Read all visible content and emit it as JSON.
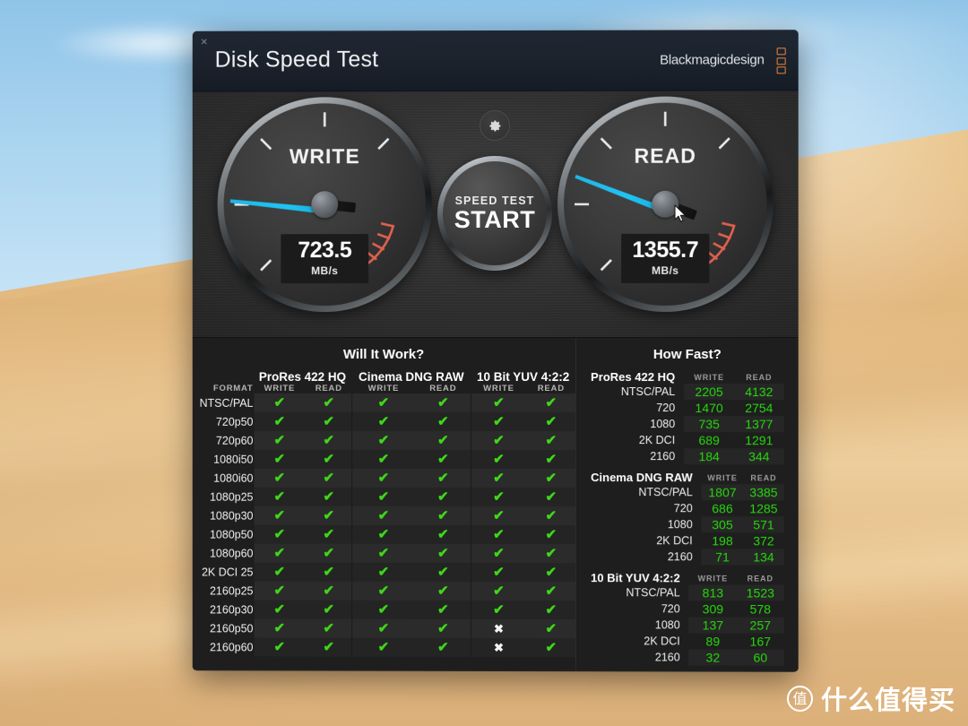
{
  "window": {
    "title": "Disk Speed Test",
    "brand": "Blackmagicdesign",
    "close_label": "×"
  },
  "gauges": {
    "write": {
      "label": "WRITE",
      "value": "723.5",
      "unit": "MB/s",
      "needle_angle_deg": 186
    },
    "read": {
      "label": "READ",
      "value": "1355.7",
      "unit": "MB/s",
      "needle_angle_deg": 201
    }
  },
  "controls": {
    "settings_icon": "gear-icon",
    "start_top_label": "SPEED TEST",
    "start_main_label": "START"
  },
  "will_it_work": {
    "heading": "Will It Work?",
    "format_header": "FORMAT",
    "groups": [
      "ProRes 422 HQ",
      "Cinema DNG RAW",
      "10 Bit YUV 4:2:2"
    ],
    "sub_headers": [
      "WRITE",
      "READ"
    ],
    "ok_mark": "✔",
    "fail_mark": "✖",
    "rows": [
      {
        "format": "NTSC/PAL",
        "marks": [
          true,
          true,
          true,
          true,
          true,
          true
        ]
      },
      {
        "format": "720p50",
        "marks": [
          true,
          true,
          true,
          true,
          true,
          true
        ]
      },
      {
        "format": "720p60",
        "marks": [
          true,
          true,
          true,
          true,
          true,
          true
        ]
      },
      {
        "format": "1080i50",
        "marks": [
          true,
          true,
          true,
          true,
          true,
          true
        ]
      },
      {
        "format": "1080i60",
        "marks": [
          true,
          true,
          true,
          true,
          true,
          true
        ]
      },
      {
        "format": "1080p25",
        "marks": [
          true,
          true,
          true,
          true,
          true,
          true
        ]
      },
      {
        "format": "1080p30",
        "marks": [
          true,
          true,
          true,
          true,
          true,
          true
        ]
      },
      {
        "format": "1080p50",
        "marks": [
          true,
          true,
          true,
          true,
          true,
          true
        ]
      },
      {
        "format": "1080p60",
        "marks": [
          true,
          true,
          true,
          true,
          true,
          true
        ]
      },
      {
        "format": "2K DCI 25",
        "marks": [
          true,
          true,
          true,
          true,
          true,
          true
        ]
      },
      {
        "format": "2160p25",
        "marks": [
          true,
          true,
          true,
          true,
          true,
          true
        ]
      },
      {
        "format": "2160p30",
        "marks": [
          true,
          true,
          true,
          true,
          true,
          true
        ]
      },
      {
        "format": "2160p50",
        "marks": [
          true,
          true,
          true,
          true,
          false,
          true
        ]
      },
      {
        "format": "2160p60",
        "marks": [
          true,
          true,
          true,
          true,
          false,
          true
        ]
      }
    ]
  },
  "how_fast": {
    "heading": "How Fast?",
    "col_write": "WRITE",
    "col_read": "READ",
    "sections": [
      {
        "title": "ProRes 422 HQ",
        "rows": [
          {
            "format": "NTSC/PAL",
            "write": "2205",
            "read": "4132"
          },
          {
            "format": "720",
            "write": "1470",
            "read": "2754"
          },
          {
            "format": "1080",
            "write": "735",
            "read": "1377"
          },
          {
            "format": "2K DCI",
            "write": "689",
            "read": "1291"
          },
          {
            "format": "2160",
            "write": "184",
            "read": "344"
          }
        ]
      },
      {
        "title": "Cinema DNG RAW",
        "rows": [
          {
            "format": "NTSC/PAL",
            "write": "1807",
            "read": "3385"
          },
          {
            "format": "720",
            "write": "686",
            "read": "1285"
          },
          {
            "format": "1080",
            "write": "305",
            "read": "571"
          },
          {
            "format": "2K DCI",
            "write": "198",
            "read": "372"
          },
          {
            "format": "2160",
            "write": "71",
            "read": "134"
          }
        ]
      },
      {
        "title": "10 Bit YUV 4:2:2",
        "rows": [
          {
            "format": "NTSC/PAL",
            "write": "813",
            "read": "1523"
          },
          {
            "format": "720",
            "write": "309",
            "read": "578"
          },
          {
            "format": "1080",
            "write": "137",
            "read": "257"
          },
          {
            "format": "2K DCI",
            "write": "89",
            "read": "167"
          },
          {
            "format": "2160",
            "write": "32",
            "read": "60"
          }
        ]
      }
    ]
  },
  "watermark": {
    "badge": "值",
    "text": "什么值得买"
  },
  "colors": {
    "needle": "#20c4f2",
    "ok": "#3fd81a",
    "value": "#25d80c",
    "brand_orange": "#e8863c",
    "redzone": "#e0614e"
  }
}
